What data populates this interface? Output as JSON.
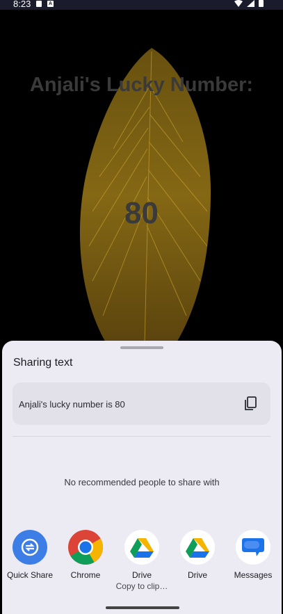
{
  "status_bar": {
    "time": "8:23",
    "icons": [
      "sim-card-icon",
      "accessibility-a-icon",
      "wifi-icon",
      "signal-icon",
      "battery-icon"
    ]
  },
  "background": {
    "title": "Anjali's Lucky Number:",
    "number": "80",
    "feather_color": "#c9a227"
  },
  "share_sheet": {
    "title": "Sharing text",
    "preview_text": "Anjali's lucky number is 80",
    "copy_icon": "copy-icon",
    "empty_message": "No recommended people to share with",
    "apps": [
      {
        "label": "Quick Share",
        "sublabel": "",
        "icon": "quick-share-icon",
        "color": "#3d7de6"
      },
      {
        "label": "Chrome",
        "sublabel": "",
        "icon": "chrome-icon",
        "color": "#1a73e8"
      },
      {
        "label": "Drive",
        "sublabel": "Copy to clip…",
        "icon": "drive-icon",
        "color": "#0f9d58"
      },
      {
        "label": "Drive",
        "sublabel": "",
        "icon": "drive-icon",
        "color": "#0f9d58"
      },
      {
        "label": "Messages",
        "sublabel": "",
        "icon": "messages-icon",
        "color": "#1a73e8"
      }
    ]
  }
}
